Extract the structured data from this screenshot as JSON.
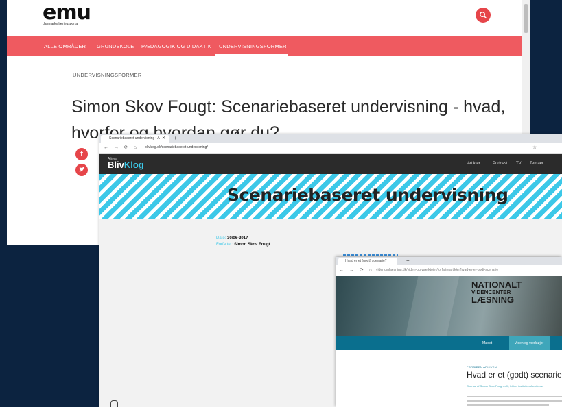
{
  "emu": {
    "logo_text": "emu",
    "logo_subtitle": "danmarks læringsportal",
    "nav": [
      "ALLE OMRÅDER",
      "GRUNDSKOLE",
      "PÆDAGOGIK OG DIDAKTIK",
      "UNDERVISNINGSFORMER"
    ],
    "active_nav": "UNDERVISNINGSFORMER",
    "kicker": "UNDERVISNINGSFORMER",
    "title": "Simon Skov Fougt: Scenariebaseret undervisning - hvad, hvorfor og hvordan gør du?",
    "social": [
      "facebook-icon",
      "twitter-icon"
    ],
    "colors": {
      "accent": "#ef5a60",
      "dark_bg": "#0c2340"
    }
  },
  "blivklog": {
    "tab_title": "Scenariebaseret undervisning • A",
    "url": "blivklog.dk/scenariebaseret-undervisning/",
    "logo_small": "Alinea",
    "logo_bliv": "Bliv",
    "logo_klog": "Klog",
    "nav": [
      "Artikler",
      "Podcast",
      "TV",
      "Temaer"
    ],
    "hero_title": "Scenariebaseret undervisning",
    "date_label": "Dato:",
    "date_value": "30/06-2017",
    "author_label": "Forfatter:",
    "author_value": "Simon Skov Fougt",
    "colors": {
      "accent": "#3cc8e8"
    }
  },
  "videncenter": {
    "tab_title": "Hvad er et (godt) scenarie?",
    "url": "videnomlaesning.dk/viden-og-vaerktojer/forfatterartikler/hvad-er-et-godt-scenarie",
    "brand_line1": "NATIONALT",
    "brand_line2": "VIDENCENTER",
    "brand_line3": "LÆSNING",
    "menu": [
      "Mødet",
      "Viden og værktøjer"
    ],
    "kicker": "FORSIDEN ARKIVEN",
    "title": "Hvad er et (godt) scenarie?",
    "author": "Oversat af Simon Skov Fougt m.fl., lektor, institutionsfunktionær",
    "colors": {
      "menu": "#0a6f8e"
    }
  }
}
